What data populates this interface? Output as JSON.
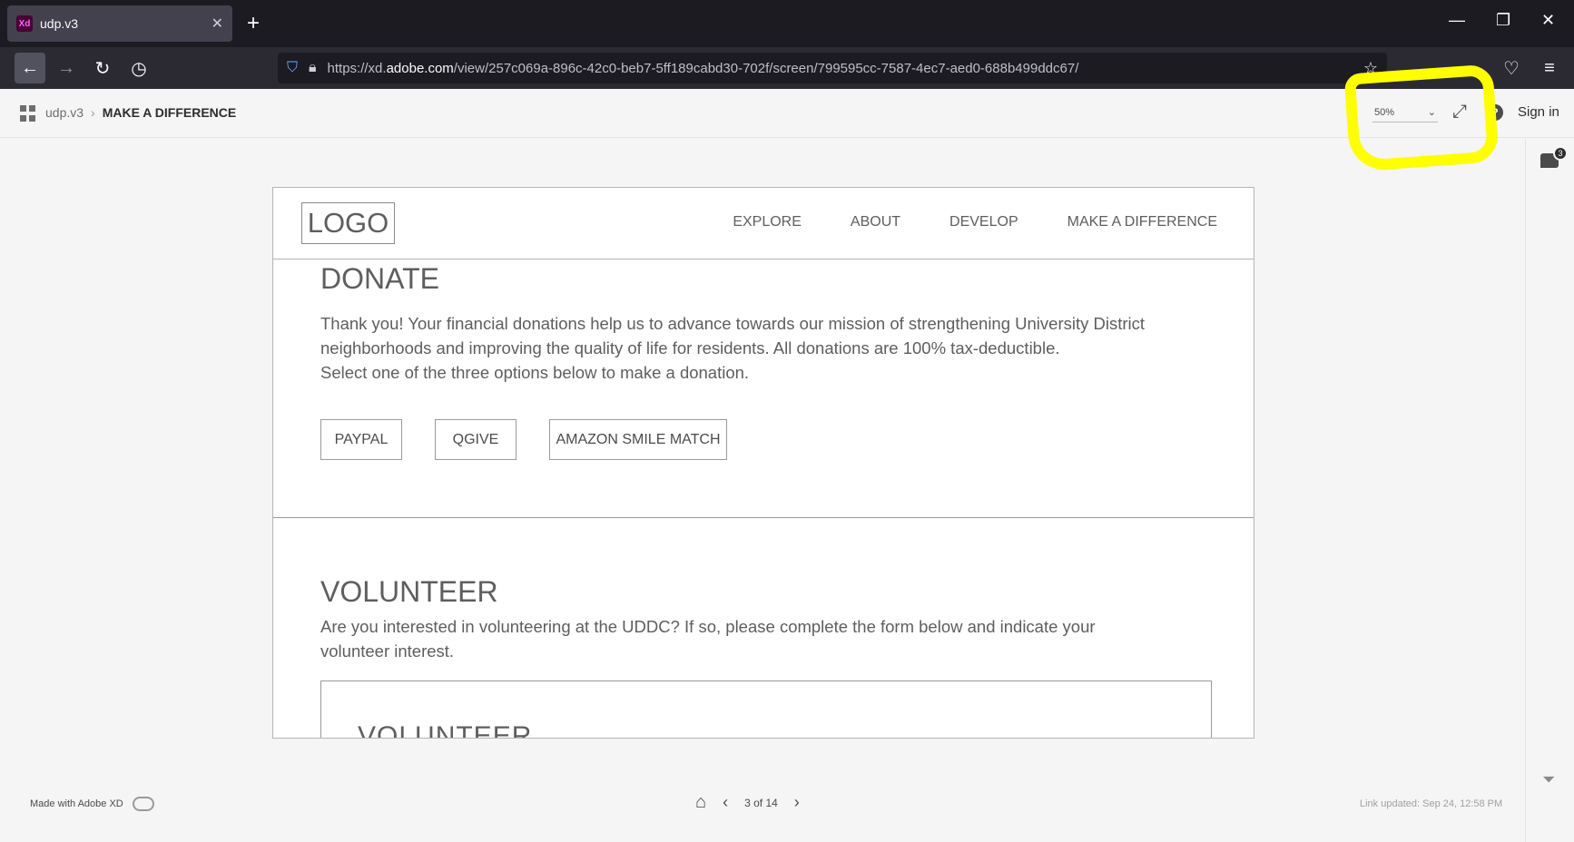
{
  "browser": {
    "tab_title": "udp.v3",
    "tab_favicon": "Xd",
    "url_prefix": "https://xd.",
    "url_domain": "adobe.com",
    "url_path": "/view/257c069a-896c-42c0-beb7-5ff189cabd30-702f/screen/799595cc-7587-4ec7-aed0-688b499ddc67/"
  },
  "xd": {
    "breadcrumb_project": "udp.v3",
    "breadcrumb_current": "MAKE A DIFFERENCE",
    "zoom_value": "50%",
    "sign_in": "Sign in",
    "comment_count": "3",
    "made_with": "Made with Adobe XD",
    "page_indicator": "3 of 14",
    "link_updated": "Link updated: Sep 24, 12:58 PM"
  },
  "site": {
    "logo": "LOGO",
    "nav": [
      "EXPLORE",
      "ABOUT",
      "DEVELOP",
      "MAKE A DIFFERENCE"
    ],
    "donate_title": "DONATE",
    "donate_line1": "Thank you! Your financial donations help us to advance towards our mission of strengthening University District",
    "donate_line2": "neighborhoods and improving the quality of life for residents. All donations are 100% tax-deductible.",
    "donate_line3": "Select one of the three options below to make a donation.",
    "buttons": [
      "PAYPAL",
      "QGIVE",
      "AMAZON SMILE MATCH"
    ],
    "volunteer_title": "VOLUNTEER",
    "volunteer_line1": "Are you interested in volunteering at the UDDC? If so, please complete the form below and indicate your",
    "volunteer_line2": "volunteer interest.",
    "volunteer_box_title": "VOLUNTEER"
  },
  "colors": {
    "highlight": "#ffff00",
    "chrome_dark": "#1c1b22",
    "xd_favicon": "#470137"
  }
}
